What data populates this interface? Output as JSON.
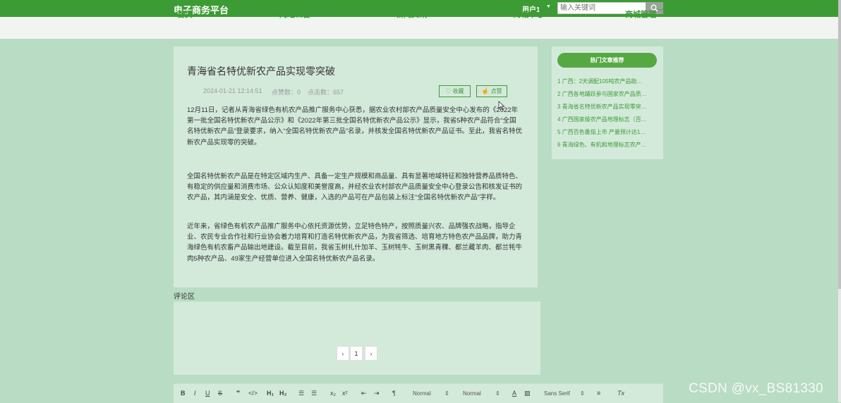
{
  "header": {
    "brand": "电子商务平台",
    "user": "用户1",
    "search_placeholder": "输入关键词"
  },
  "nav": [
    "首页",
    "网站公告",
    "新闻资讯",
    "商城中心",
    "商城管理"
  ],
  "article": {
    "title": "青海省名特优新农产品实现零突破",
    "date": "2024-01-21 12:14:51",
    "likes": "点赞数：0",
    "clicks": "点击数：657",
    "favorite_label": "收藏",
    "like_label": "点赞",
    "paragraphs": [
      "12月11日，记者从青海省绿色有机农产品推广服务中心获悉，据农业农村部农产品质量安全中心发布的《2022年第一批全国名特优新农产品公示》和《2022年第三批全国名特优新农产品公示》显示，我省5种农产品符合“全国名特优新农产品”登录要求，纳入“全国名特优新农产品”名录，并核发全国名特优新农产品证书。至此，我省名特优新农产品实现零的突破。",
      "全国名特优新农产品是在特定区域内生产、具备一定生产规模和商品量、具有显著地域特征和独特营养品质特色、有稳定的供应量和消费市场、公众认知度和美誉度高，并经农业农村部农产品质量安全中心登录公告和核发证书的农产品，其内涵是安全、优质、营养、健康，入选的产品可在产品包装上标注“全国名特优新农产品”字样。",
      "近年来，省绿色有机农产品推广服务中心依托资源优势，立足特色特产，按照质量兴农、品牌强农战略，指导企业、农民专业合作社和行业协会着力培育和打造名特优新农产品，为我省筛选、培育地方特色农产品品牌，助力青海绿色有机农畜产品输出地建设。截至目前，我省玉树扎什加羊、玉树牦牛、玉树黑青稞、都兰藏羊肉、都兰牦牛肉5种农产品、49家生产经营单位进入全国名特优新农产品名录。"
    ]
  },
  "comments": {
    "label": "评论区",
    "pager": [
      "‹",
      "1",
      "›"
    ]
  },
  "sidebar": {
    "title": "热门文章推荐",
    "items": [
      "1  广西：2天调配105吨农产品助…",
      "2  广西各地踊跃参与国家农产品质…",
      "3  青海省名特优新农产品实现零突…",
      "4  广西国家级农产品地理标志（百…",
      "5  广西百色番茄上市 产量预计达1…",
      "6  青海绿色、有机和地理标志农产…"
    ]
  },
  "editor": {
    "header_select": "Normal",
    "size_select": "Normal",
    "font_select": "Sans Serif"
  },
  "watermark": "CSDN @vx_BS81330"
}
